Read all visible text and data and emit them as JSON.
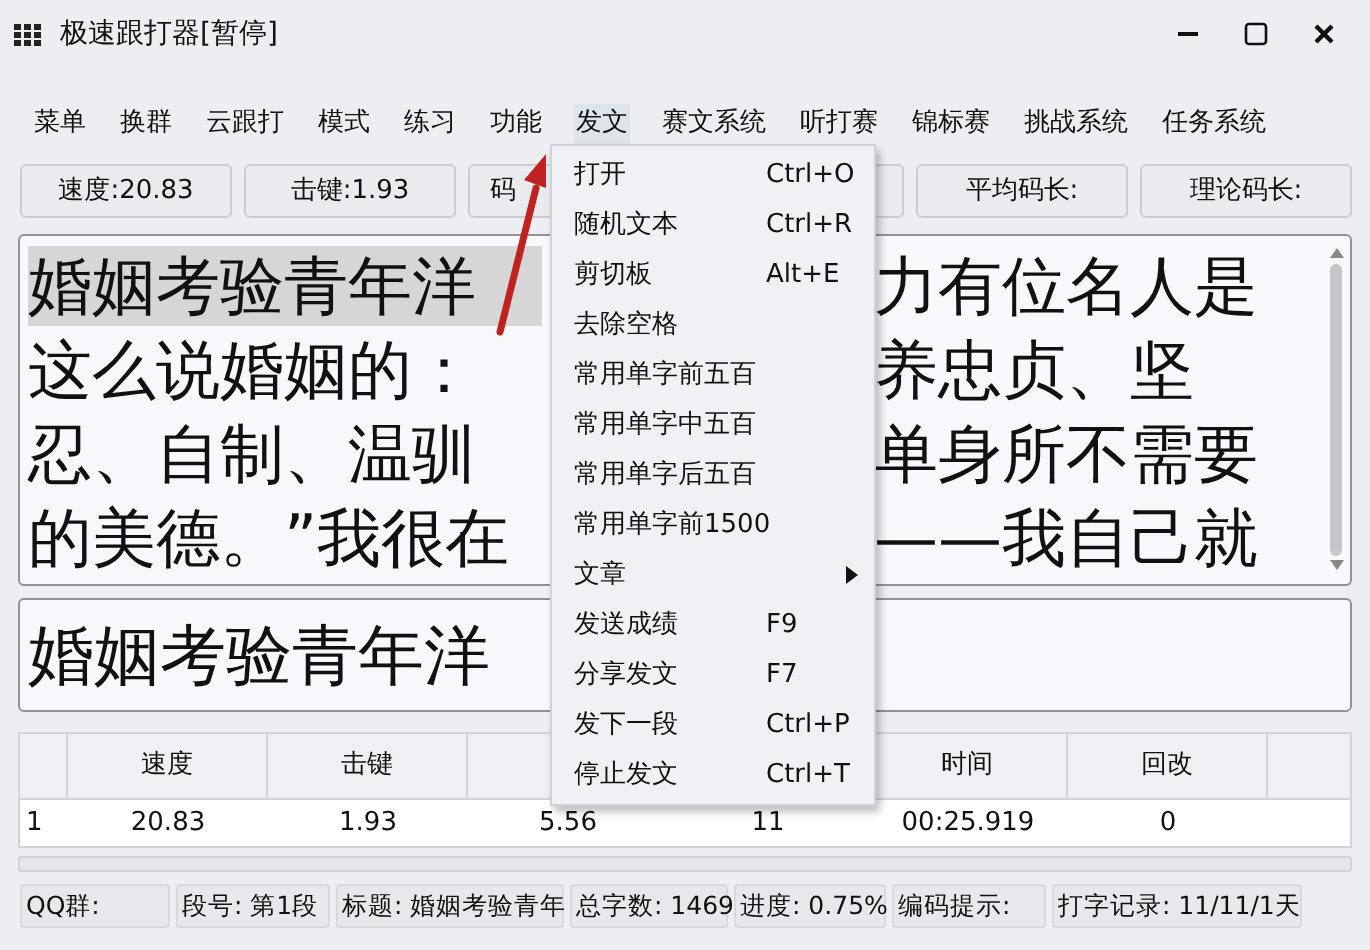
{
  "window": {
    "title": "极速跟打器[暂停]"
  },
  "menu": [
    {
      "label": "菜单",
      "selected": false
    },
    {
      "label": "换群",
      "selected": false
    },
    {
      "label": "云跟打",
      "selected": false
    },
    {
      "label": "模式",
      "selected": false
    },
    {
      "label": "练习",
      "selected": false
    },
    {
      "label": "功能",
      "selected": false
    },
    {
      "label": "发文",
      "selected": true
    },
    {
      "label": "赛文系统",
      "selected": false
    },
    {
      "label": "听打赛",
      "selected": false
    },
    {
      "label": "锦标赛",
      "selected": false
    },
    {
      "label": "挑战系统",
      "selected": false
    },
    {
      "label": "任务系统",
      "selected": false
    }
  ],
  "stats_buttons": [
    {
      "label": "速度:20.83",
      "covered": false
    },
    {
      "label": "击键:1.93",
      "covered": false
    },
    {
      "label": "码",
      "covered": true
    },
    {
      "label": "平均码长:",
      "covered": false
    },
    {
      "label": "理论码长:",
      "covered": false
    }
  ],
  "source_text": {
    "lines": [
      {
        "left": "婚姻考验青年洋",
        "highlighted": true,
        "right": "力有位名人是"
      },
      {
        "left": "这么说婚姻的：",
        "highlighted": false,
        "right": "养忠贞、坚"
      },
      {
        "left": "忍、自制、温驯",
        "highlighted": false,
        "right": "单身所不需要"
      },
      {
        "left": "的美德。”我很在",
        "highlighted": false,
        "right": "——我自己就"
      }
    ]
  },
  "typing_input": {
    "value": "婚姻考验青年洋"
  },
  "results_table": {
    "columns": [
      "",
      "速度",
      "击键",
      "",
      "",
      "时间",
      "回改"
    ],
    "rows": [
      [
        "1",
        "20.83",
        "1.93",
        "5.56",
        "11",
        "00:25.919",
        "0"
      ]
    ]
  },
  "dropdown": {
    "items": [
      {
        "label": "打开",
        "shortcut": "Ctrl+O",
        "submenu": false
      },
      {
        "label": "随机文本",
        "shortcut": "Ctrl+R",
        "submenu": false
      },
      {
        "label": "剪切板",
        "shortcut": "Alt+E",
        "submenu": false
      },
      {
        "label": "去除空格",
        "submenu": false
      },
      {
        "label": "常用单字前五百",
        "submenu": false
      },
      {
        "label": "常用单字中五百",
        "submenu": false
      },
      {
        "label": "常用单字后五百",
        "submenu": false
      },
      {
        "label": "常用单字前1500",
        "submenu": false
      },
      {
        "label": "文章",
        "submenu": true
      },
      {
        "label": "发送成绩",
        "shortcut": "F9",
        "submenu": false
      },
      {
        "label": "分享发文",
        "shortcut": "F7",
        "submenu": false
      },
      {
        "label": "发下一段",
        "shortcut": "Ctrl+P",
        "submenu": false
      },
      {
        "label": "停止发文",
        "shortcut": "Ctrl+T",
        "submenu": false
      }
    ]
  },
  "status_bar": [
    "QQ群:",
    "段号: 第1段",
    "标题: 婚姻考验青年",
    "总字数: 1469",
    "进度: 0.75%",
    "编码提示:",
    "打字记录: 11/11/1天"
  ]
}
